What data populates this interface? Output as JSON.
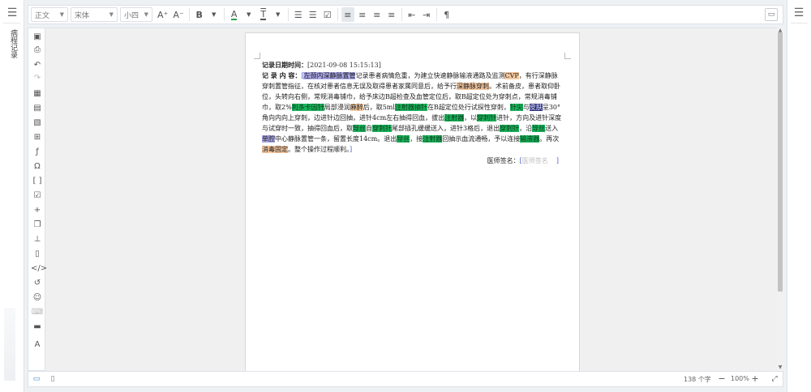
{
  "left_panel": {
    "menu_icon": "hamburger-icon",
    "label": "病程记录"
  },
  "right_panel": {
    "menu_icon": "hamburger-icon"
  },
  "toolbar": {
    "paragraph_style": "正文",
    "font_family": "宋体",
    "font_size": "小四",
    "grow_font": "A⁺",
    "shrink_font": "A⁻",
    "bold": "B",
    "font_color_glyph": "A",
    "font_color": "#2e9e4a",
    "highlight_glyph": "T",
    "pilcrow": "¶",
    "right_icon": "comment-icon"
  },
  "document": {
    "date_label": "记录日期时间：",
    "date_value": "[2021-09-08 15:15:13]",
    "content_label": "记 录 内 容：",
    "bracket_open": "[",
    "bracket_close": "]",
    "segments": [
      {
        "t": "左颈内深静脉置管",
        "c": "hl-p"
      },
      {
        "t": "记录患者病情危重，为建立快速静脉输液通路及监测"
      },
      {
        "t": "CVP",
        "c": "hl-o"
      },
      {
        "t": "，有行深静脉穿刺置管指征，在核对患者信息无误及取得患者家属同意后，给予行"
      },
      {
        "t": "深静脉穿刺",
        "c": "hl-o"
      },
      {
        "t": "。术前备皮，患者取仰卧位，头转向右侧，常规消毒铺巾，给予床边B超检查及血管定位后，取B超定位处为穿刺点，常规消毒铺巾，取2%"
      },
      {
        "t": "利多卡因针",
        "c": "hl-g"
      },
      {
        "t": "局部浸润"
      },
      {
        "t": "麻醉",
        "c": "hl-o"
      },
      {
        "t": "后，取5ml"
      },
      {
        "t": "注射器抽针",
        "c": "hl-g"
      },
      {
        "t": "在B超定位处行试探性穿刺，"
      },
      {
        "t": "针尖",
        "c": "hl-g"
      },
      {
        "t": "与"
      },
      {
        "t": "皮肤",
        "c": "hl-db"
      },
      {
        "t": "呈30°角向内向上穿刺，边进针边回抽，进针4cm左右抽得回血，拔出"
      },
      {
        "t": "注射器",
        "c": "hl-g"
      },
      {
        "t": "，以"
      },
      {
        "t": "穿刺针",
        "c": "hl-g"
      },
      {
        "t": "进针，方向及进针深度与试穿时一致，抽得回血后，取"
      },
      {
        "t": "导丝",
        "c": "hl-g"
      },
      {
        "t": "自"
      },
      {
        "t": "穿刺针",
        "c": "hl-g"
      },
      {
        "t": "尾部插孔缓缓送入，进针3格后，退出"
      },
      {
        "t": "穿刺针",
        "c": "hl-g"
      },
      {
        "t": "，沿"
      },
      {
        "t": "导丝",
        "c": "hl-g"
      },
      {
        "t": "送入"
      },
      {
        "t": "单腔",
        "c": "hl-p"
      },
      {
        "t": "中心静脉置管一条，留置长度14cm。退出"
      },
      {
        "t": "导丝",
        "c": "hl-g"
      },
      {
        "t": "，接"
      },
      {
        "t": "注射器",
        "c": "hl-g"
      },
      {
        "t": "回抽示血流通畅，予以连接"
      },
      {
        "t": "输液器",
        "c": "hl-g"
      },
      {
        "t": "。再次"
      },
      {
        "t": "消毒固定",
        "c": "hl-o"
      },
      {
        "t": "。整个操作过程顺利。"
      }
    ],
    "sign_label": "医师签名：",
    "sign_placeholder": "医师签名"
  },
  "status_bar": {
    "word_count": "138 个字",
    "zoom": "100%",
    "zoom_out": "−",
    "zoom_in": "+",
    "fullscreen_icon": "expand-icon"
  }
}
